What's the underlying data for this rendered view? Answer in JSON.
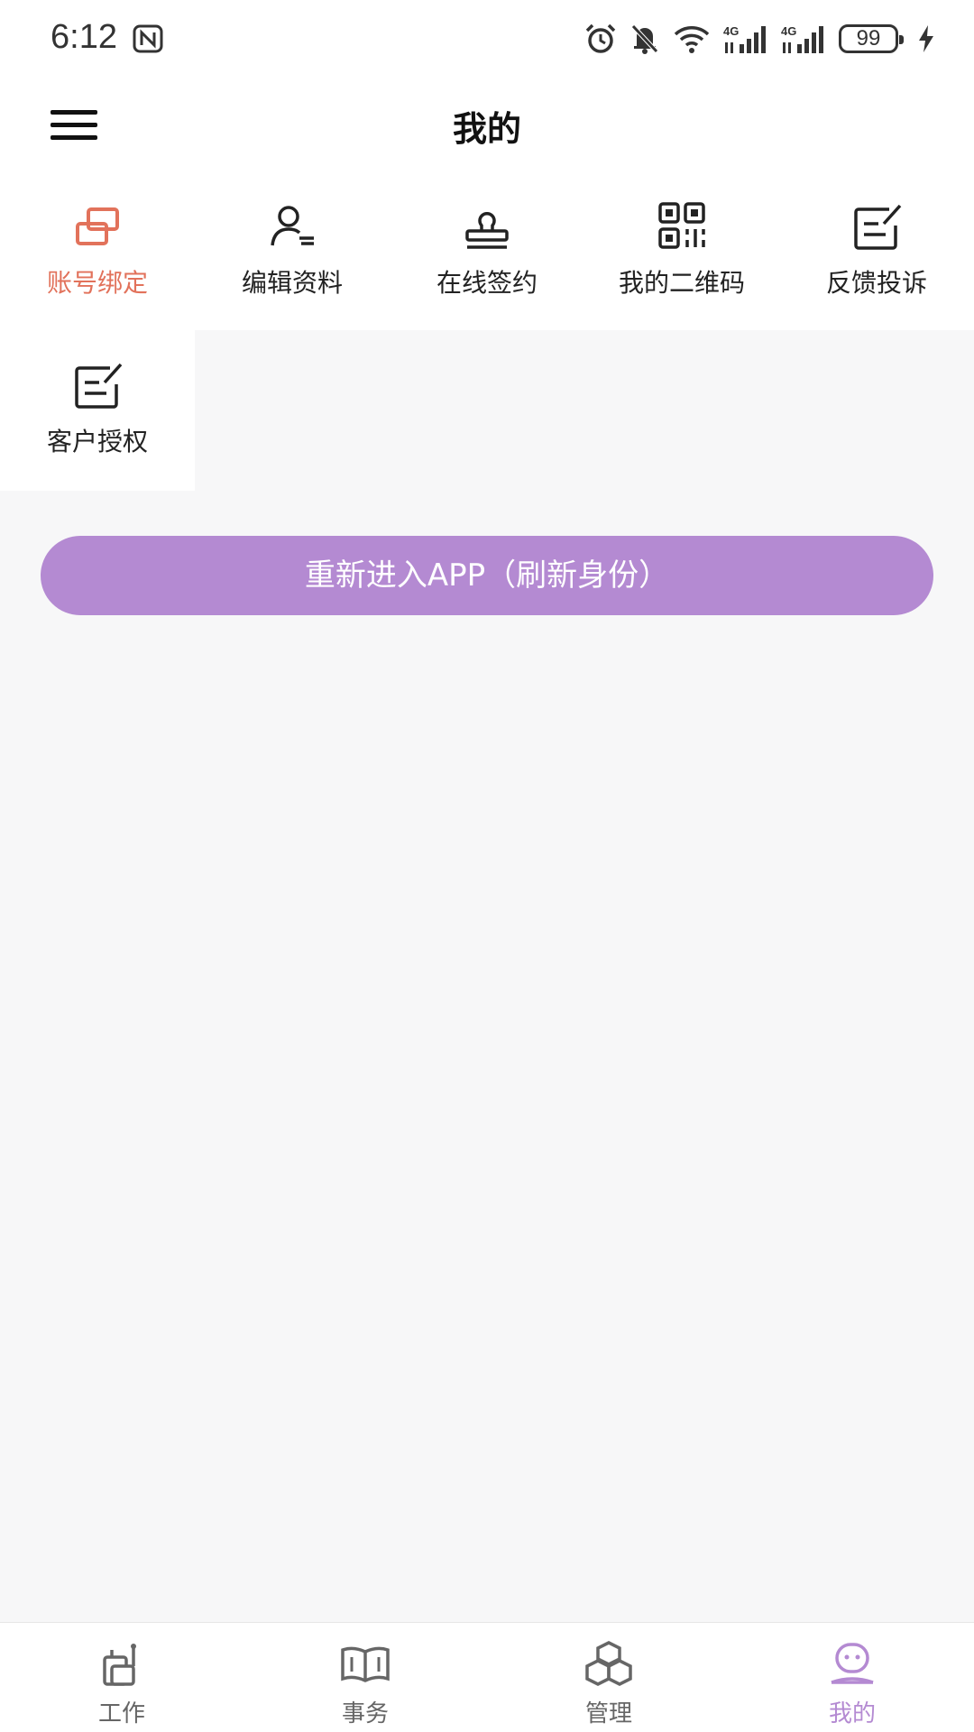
{
  "status": {
    "time": "6:12",
    "network_1": "4G",
    "network_2": "4G",
    "battery": "99"
  },
  "header": {
    "title": "我的",
    "menu_icon": "hamburger-menu-icon"
  },
  "grid": {
    "items": [
      {
        "label": "账号绑定",
        "icon": "link-accounts-icon",
        "active": true
      },
      {
        "label": "编辑资料",
        "icon": "edit-profile-icon",
        "active": false
      },
      {
        "label": "在线签约",
        "icon": "stamp-icon",
        "active": false
      },
      {
        "label": "我的二维码",
        "icon": "qr-code-icon",
        "active": false
      },
      {
        "label": "反馈投诉",
        "icon": "feedback-icon",
        "active": false
      },
      {
        "label": "客户授权",
        "icon": "authorization-icon",
        "active": false
      }
    ]
  },
  "refresh_button": {
    "label": "重新进入APP（刷新身份）"
  },
  "bottom_nav": {
    "items": [
      {
        "label": "工作",
        "icon": "work-icon",
        "active": false
      },
      {
        "label": "事务",
        "icon": "book-icon",
        "active": false
      },
      {
        "label": "管理",
        "icon": "cubes-icon",
        "active": false
      },
      {
        "label": "我的",
        "icon": "user-face-icon",
        "active": true
      }
    ]
  },
  "colors": {
    "accent": "#b48ad2",
    "active_grid": "#e2725b",
    "background": "#f7f7f8"
  }
}
